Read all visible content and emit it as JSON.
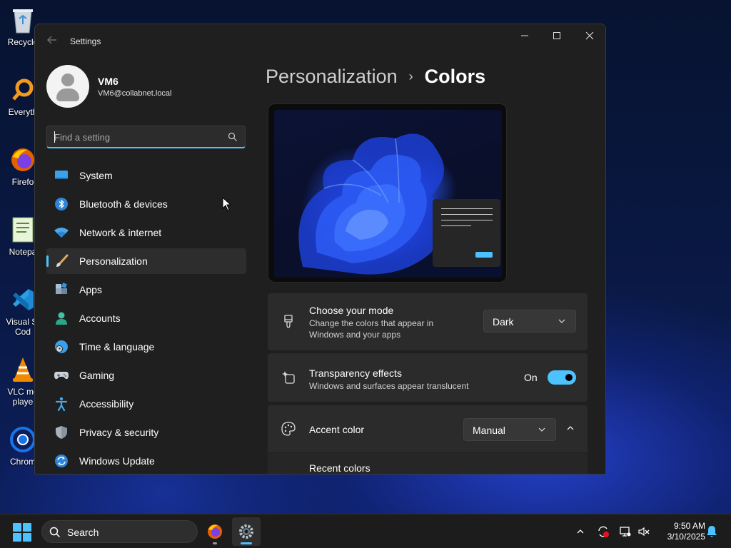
{
  "desktop": {
    "icons": [
      {
        "label": "Recycle",
        "icon": "recycle-bin-icon"
      },
      {
        "label": "Everyth",
        "icon": "everything-search-icon"
      },
      {
        "label": "Firefo",
        "icon": "firefox-icon"
      },
      {
        "label": "Notepa",
        "icon": "notepad-icon"
      },
      {
        "label": "Visual St",
        "label2": "Cod",
        "icon": "vscode-icon"
      },
      {
        "label": "VLC me",
        "label2": "playe",
        "icon": "vlc-icon"
      },
      {
        "label": "Chrom",
        "icon": "chrome-icon"
      }
    ]
  },
  "window": {
    "title": "Settings",
    "controls": {
      "minimize": "—",
      "maximize": "☐",
      "close": "✕"
    }
  },
  "profile": {
    "name": "VM6",
    "email": "VM6@collabnet.local"
  },
  "search": {
    "placeholder": "Find a setting"
  },
  "nav": {
    "items": [
      {
        "label": "System",
        "icon": "system-icon"
      },
      {
        "label": "Bluetooth & devices",
        "icon": "bluetooth-icon"
      },
      {
        "label": "Network & internet",
        "icon": "wifi-icon"
      },
      {
        "label": "Personalization",
        "icon": "brush-icon",
        "active": true
      },
      {
        "label": "Apps",
        "icon": "apps-icon"
      },
      {
        "label": "Accounts",
        "icon": "accounts-icon"
      },
      {
        "label": "Time & language",
        "icon": "clock-globe-icon"
      },
      {
        "label": "Gaming",
        "icon": "gamepad-icon"
      },
      {
        "label": "Accessibility",
        "icon": "accessibility-icon"
      },
      {
        "label": "Privacy & security",
        "icon": "shield-icon"
      },
      {
        "label": "Windows Update",
        "icon": "update-icon"
      }
    ]
  },
  "main": {
    "breadcrumb": {
      "parent": "Personalization",
      "separator": "›",
      "current": "Colors"
    },
    "mode_card": {
      "title": "Choose your mode",
      "subtitle_line1": "Change the colors that appear in",
      "subtitle_line2": "Windows and your apps",
      "value": "Dark"
    },
    "transparency_card": {
      "title": "Transparency effects",
      "subtitle": "Windows and surfaces appear translucent",
      "state_label": "On",
      "enabled": true
    },
    "accent_card": {
      "title": "Accent color",
      "value": "Manual",
      "expanded": true
    },
    "recent_colors": {
      "title": "Recent colors"
    }
  },
  "taskbar": {
    "search_label": "Search",
    "time": "9:50 AM",
    "date": "3/10/2025"
  },
  "colors": {
    "accent": "#4cc2ff",
    "window_bg": "#1f1f1f",
    "card_bg": "#2b2b2b"
  }
}
